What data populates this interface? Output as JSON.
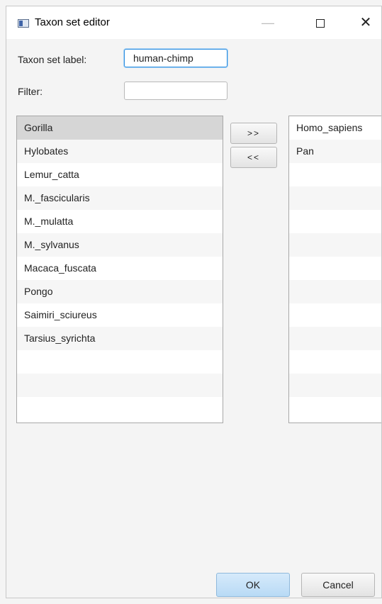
{
  "window": {
    "title": "Taxon set editor",
    "icon": "app-icon"
  },
  "form": {
    "label_text": "Taxon set label:",
    "label_value": "human-chimp",
    "filter_text": "Filter:",
    "filter_value": ""
  },
  "available": [
    "Gorilla",
    "Hylobates",
    "Lemur_catta",
    "M._fascicularis",
    "M._mulatta",
    "M._sylvanus",
    "Macaca_fuscata",
    "Pongo",
    "Saimiri_sciureus",
    "Tarsius_syrichta"
  ],
  "selected_available": "Gorilla",
  "included": [
    "Homo_sapiens",
    "Pan"
  ],
  "buttons": {
    "add": ">>",
    "remove": "<<",
    "ok": "OK",
    "cancel": "Cancel"
  },
  "colors": {
    "focus_border": "#2e8fe0",
    "selected_row": "#d6d6d6",
    "ok_button": "#b8daf5"
  }
}
